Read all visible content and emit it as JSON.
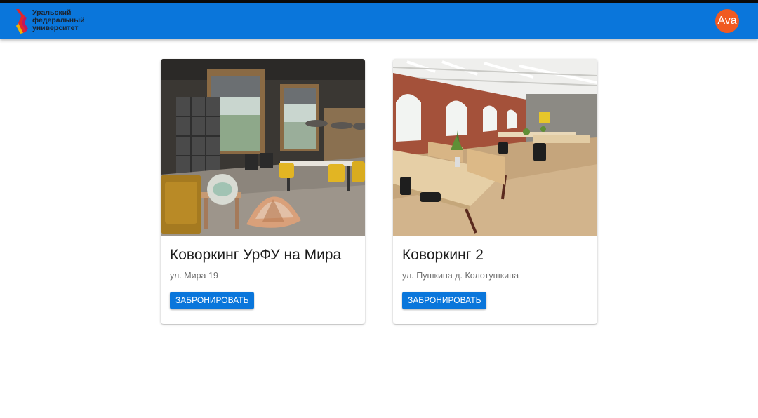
{
  "header": {
    "logo_lines": [
      "Уральский",
      "федеральный",
      "университет"
    ],
    "avatar_text": "Ava",
    "bar_color": "#0a76db",
    "avatar_color": "#f05a22"
  },
  "cards": [
    {
      "title": "Коворкинг УрФУ на Мира",
      "address": "ул. Мира 19",
      "button_label": "ЗАБРОНИРОВАТЬ"
    },
    {
      "title": "Коворкинг 2",
      "address": "ул. Пушкина д. Колотушкина",
      "button_label": "ЗАБРОНИРОВАТЬ"
    }
  ]
}
